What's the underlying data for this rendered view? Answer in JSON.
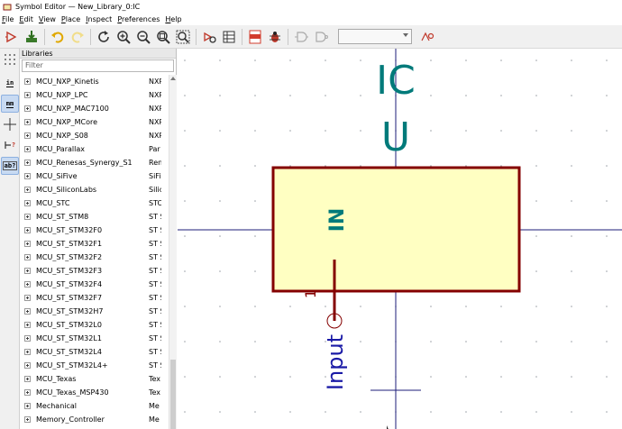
{
  "window": {
    "title": "Symbol Editor — New_Library_0:IC"
  },
  "menu": {
    "items": [
      {
        "ul": "F",
        "rest": "ile"
      },
      {
        "ul": "E",
        "rest": "dit"
      },
      {
        "ul": "V",
        "rest": "iew"
      },
      {
        "ul": "P",
        "rest": "lace"
      },
      {
        "ul": "I",
        "rest": "nspect"
      },
      {
        "ul": "P",
        "rest": "references"
      },
      {
        "ul": "H",
        "rest": "elp"
      }
    ]
  },
  "toolbar": {
    "unit_combo_value": "",
    "icons": [
      "new-symbol-icon",
      "save-icon",
      "undo-icon",
      "redo-icon",
      "refresh-icon",
      "zoom-in-icon",
      "zoom-out-icon",
      "zoom-fit-icon",
      "zoom-selection-icon",
      "symbol-properties-icon",
      "pin-table-icon",
      "datasheet-pdf-icon",
      "bug-icon",
      "convert-body-icon",
      "de-morgan-icon",
      "unit-select-icon",
      "show-pin-icon"
    ],
    "colors": {
      "accent": "#c0392b",
      "pdf": "#d23b2d"
    }
  },
  "lefttools": {
    "inch_label": "in",
    "mm_label": "mm",
    "pin_label": "?",
    "text_label": "ab?"
  },
  "libraries": {
    "header": "Libraries",
    "filter_placeholder": "Filter",
    "rows": [
      {
        "name": "MCU_NXP_Kinetis",
        "desc": "NXP"
      },
      {
        "name": "MCU_NXP_LPC",
        "desc": "NXP"
      },
      {
        "name": "MCU_NXP_MAC7100",
        "desc": "NXP"
      },
      {
        "name": "MCU_NXP_MCore",
        "desc": "NXP"
      },
      {
        "name": "MCU_NXP_S08",
        "desc": "NXP"
      },
      {
        "name": "MCU_Parallax",
        "desc": "Par"
      },
      {
        "name": "MCU_Renesas_Synergy_S1",
        "desc": "Ren"
      },
      {
        "name": "MCU_SiFive",
        "desc": "SiFi"
      },
      {
        "name": "MCU_SiliconLabs",
        "desc": "Silic"
      },
      {
        "name": "MCU_STC",
        "desc": "STC"
      },
      {
        "name": "MCU_ST_STM8",
        "desc": "ST S"
      },
      {
        "name": "MCU_ST_STM32F0",
        "desc": "ST S"
      },
      {
        "name": "MCU_ST_STM32F1",
        "desc": "ST S"
      },
      {
        "name": "MCU_ST_STM32F2",
        "desc": "ST S"
      },
      {
        "name": "MCU_ST_STM32F3",
        "desc": "ST S"
      },
      {
        "name": "MCU_ST_STM32F4",
        "desc": "ST S"
      },
      {
        "name": "MCU_ST_STM32F7",
        "desc": "ST S"
      },
      {
        "name": "MCU_ST_STM32H7",
        "desc": "ST S"
      },
      {
        "name": "MCU_ST_STM32L0",
        "desc": "ST S"
      },
      {
        "name": "MCU_ST_STM32L1",
        "desc": "ST S"
      },
      {
        "name": "MCU_ST_STM32L4",
        "desc": "ST S"
      },
      {
        "name": "MCU_ST_STM32L4+",
        "desc": "ST S"
      },
      {
        "name": "MCU_Texas",
        "desc": "Tex"
      },
      {
        "name": "MCU_Texas_MSP430",
        "desc": "Tex"
      },
      {
        "name": "Mechanical",
        "desc": "Me"
      },
      {
        "name": "Memory_Controller",
        "desc": "Me"
      }
    ]
  },
  "symbol": {
    "value_text": "IC",
    "reference_text": "U",
    "pin_name": "IN",
    "pin_number_text": "1",
    "pin_type_text": "Input",
    "colors": {
      "field": "#007a7a",
      "body_border": "#840000",
      "body_fill": "#ffffc2",
      "pin_type": "#1a1aa6",
      "axis": "#1c1c7a",
      "grid_dot": "#9aa0a6"
    }
  }
}
